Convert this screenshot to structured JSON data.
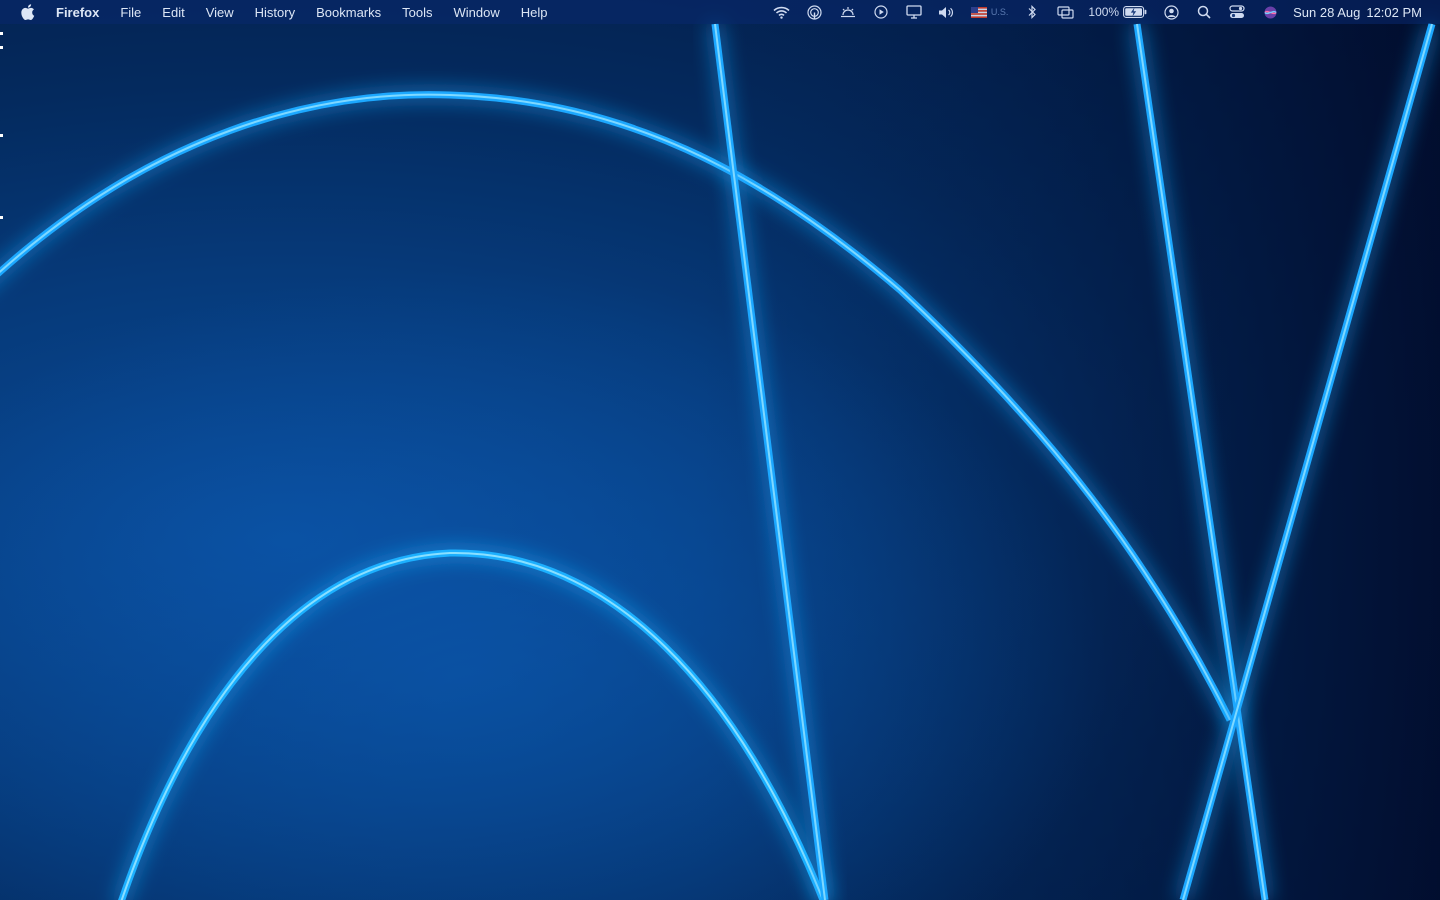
{
  "menubar": {
    "apple_icon": "apple-logo-icon",
    "app_name": "Firefox",
    "items": [
      "File",
      "Edit",
      "View",
      "History",
      "Bookmarks",
      "Tools",
      "Window",
      "Help"
    ]
  },
  "status": {
    "icons": [
      "wifi-icon",
      "airdrop-icon",
      "weather-icon",
      "play-icon",
      "display-icon",
      "volume-icon",
      "us-flag-icon",
      "bluetooth-icon",
      "screen-mirroring-icon"
    ],
    "keyboard_language": "U.S.",
    "battery_percent": "100%",
    "battery_icon": "battery-charging-icon",
    "user_icon": "user-account-icon",
    "search_icon": "spotlight-search-icon",
    "control_center_icon": "control-center-icon",
    "siri_icon": "siri-icon",
    "date": "Sun 28 Aug",
    "time": "12:02 PM"
  },
  "colors": {
    "wallpaper_base": "#042a5e",
    "wallpaper_glow": "#2fb4ff",
    "menubar_text": "#dce6f5"
  }
}
